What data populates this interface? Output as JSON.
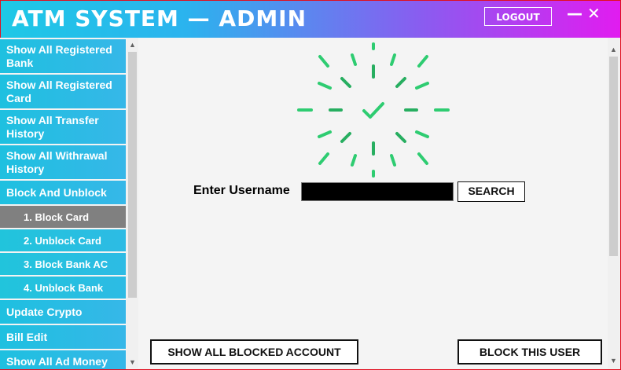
{
  "window": {
    "title": "ATM SYSTEM — ADMIN",
    "logout_label": "LOGOUT",
    "minimize_label": "—",
    "close_label": "✕"
  },
  "sidebar": {
    "items": [
      {
        "label": "Show All Registered Bank"
      },
      {
        "label": "Show All Registered Card"
      },
      {
        "label": "Show All Transfer History"
      },
      {
        "label": "Show All Withrawal History"
      },
      {
        "label": "Block And Unblock"
      },
      {
        "label": "1. Block Card",
        "active": true
      },
      {
        "label": "2. Unblock Card"
      },
      {
        "label": "3. Block Bank AC"
      },
      {
        "label": "4. Unblock Bank"
      },
      {
        "label": "Update Crypto"
      },
      {
        "label": "Bill Edit"
      },
      {
        "label": "Show All Ad Money"
      }
    ]
  },
  "search": {
    "label": "Enter Username",
    "value": "",
    "button_label": "SEARCH"
  },
  "actions": {
    "show_blocked_label": "SHOW ALL BLOCKED ACCOUNT",
    "block_user_label": "BLOCK THIS USER"
  },
  "colors": {
    "accent_cyan": "#1ec8e6",
    "accent_magenta": "#e11cf0",
    "active_item": "#808080",
    "spinner_green": "#2ecc71"
  },
  "icons": {
    "spinner": "loading-check-icon"
  }
}
